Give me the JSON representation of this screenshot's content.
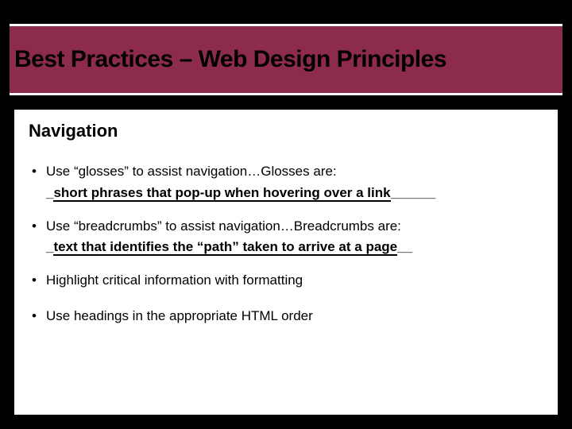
{
  "title": "Best Practices – Web Design Principles",
  "subtitle": "Navigation",
  "bullets": [
    {
      "text": "Use “glosses” to assist navigation…Glosses are:",
      "blank_fill": "short phrases that pop-up when hovering over a link",
      "blank_tail": "______"
    },
    {
      "text": "Use “breadcrumbs” to assist navigation…Breadcrumbs are:",
      "blank_fill": "text that identifies the “path” taken to arrive at a page",
      "blank_tail": "__"
    },
    {
      "text": "Highlight critical information with formatting"
    },
    {
      "text": "Use headings in the appropriate HTML order"
    }
  ]
}
